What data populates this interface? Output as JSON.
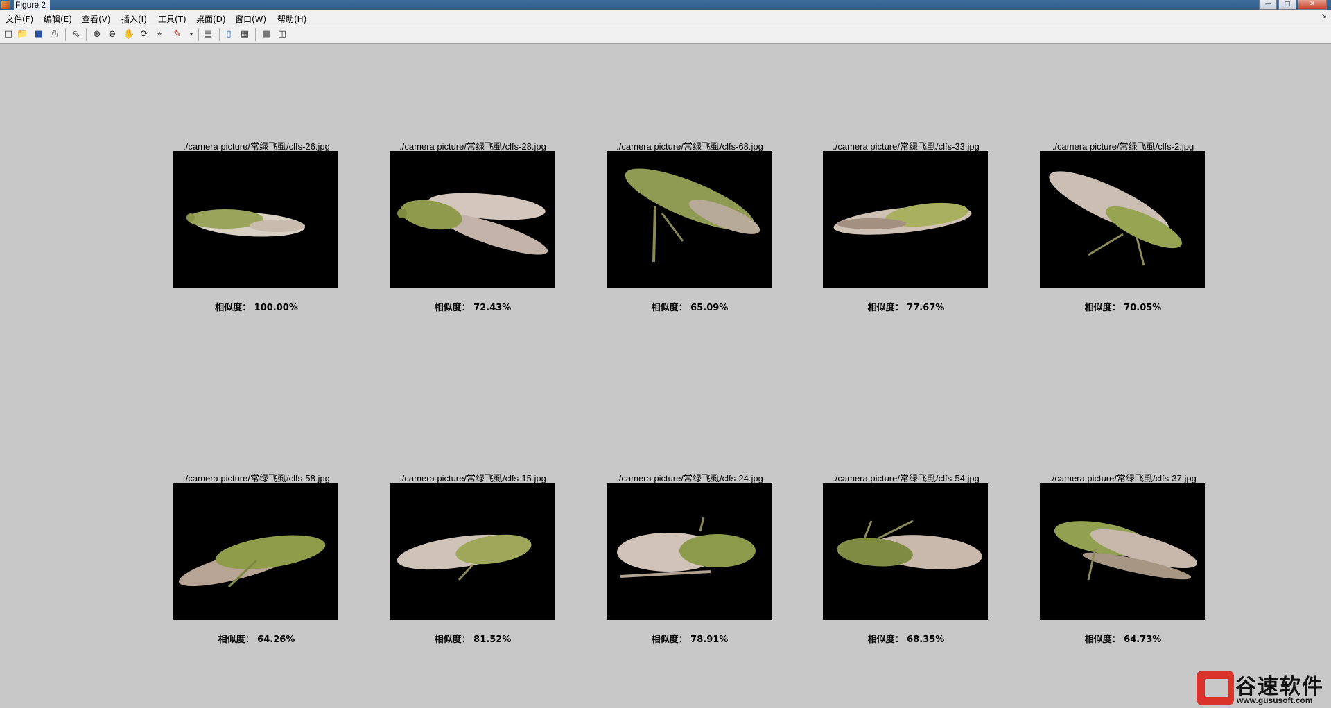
{
  "window": {
    "title": "Figure 2"
  },
  "menu": [
    "文件(F)",
    "编辑(E)",
    "查看(V)",
    "插入(I)",
    "工具(T)",
    "桌面(D)",
    "窗口(W)",
    "帮助(H)"
  ],
  "toolbar": [
    "new-figure-icon",
    "open-file-icon",
    "save-icon",
    "print-icon",
    "edit-plot-icon",
    "zoom-in-icon",
    "zoom-out-icon",
    "pan-icon",
    "rotate-3d-icon",
    "data-cursor-icon",
    "brush-icon",
    "link-plot-icon",
    "colorbar-icon",
    "legend-icon",
    "hide-plot-tools-icon",
    "show-plot-tools-icon"
  ],
  "results": [
    {
      "path": "./camera picture/常绿飞虱/clfs-26.jpg",
      "similarity": "相似度： 100.00%"
    },
    {
      "path": "./camera picture/常绿飞虱/clfs-28.jpg",
      "similarity": "相似度： 72.43%"
    },
    {
      "path": "./camera picture/常绿飞虱/clfs-68.jpg",
      "similarity": "相似度： 65.09%"
    },
    {
      "path": "./camera picture/常绿飞虱/clfs-33.jpg",
      "similarity": "相似度： 77.67%"
    },
    {
      "path": "./camera picture/常绿飞虱/clfs-2.jpg",
      "similarity": "相似度： 70.05%"
    },
    {
      "path": "./camera picture/常绿飞虱/clfs-58.jpg",
      "similarity": "相似度： 64.26%"
    },
    {
      "path": "./camera picture/常绿飞虱/clfs-15.jpg",
      "similarity": "相似度： 81.52%"
    },
    {
      "path": "./camera picture/常绿飞虱/clfs-24.jpg",
      "similarity": "相似度： 78.91%"
    },
    {
      "path": "./camera picture/常绿飞虱/clfs-54.jpg",
      "similarity": "相似度： 68.35%"
    },
    {
      "path": "./camera picture/常绿飞虱/clfs-37.jpg",
      "similarity": "相似度： 64.73%"
    }
  ],
  "watermark": {
    "name": "谷速软件",
    "url": "www.gususoft.com"
  }
}
